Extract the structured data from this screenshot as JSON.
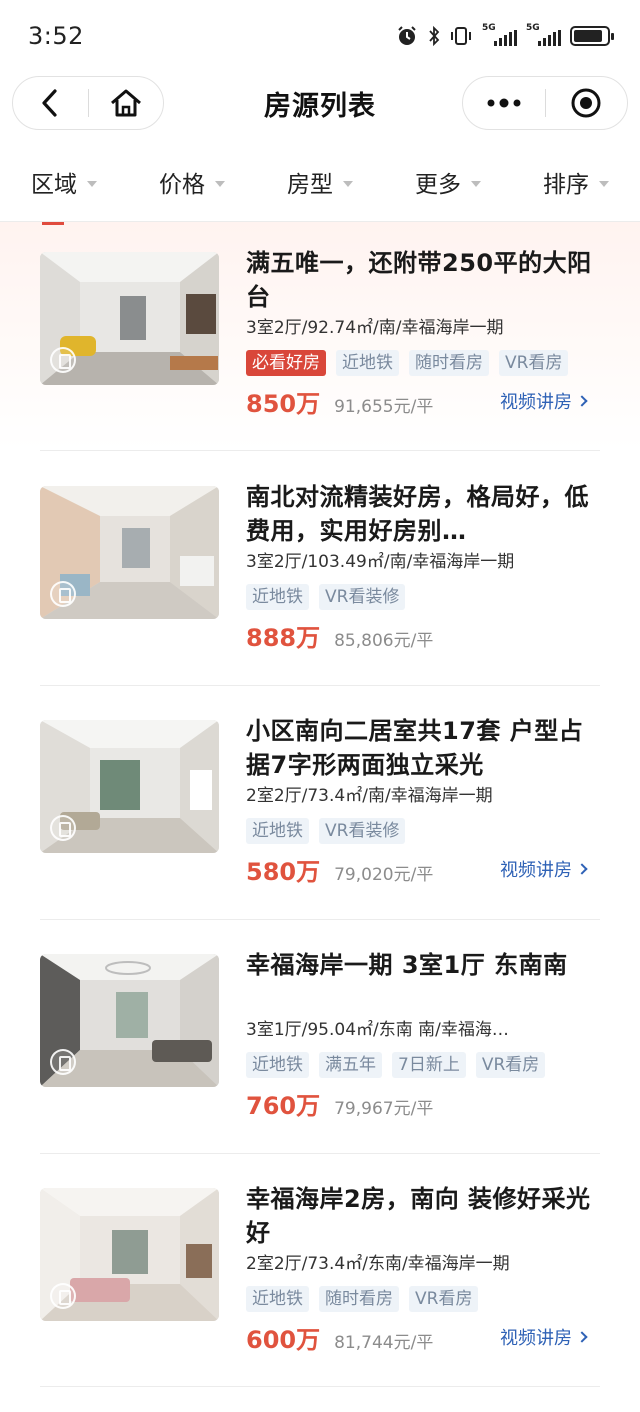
{
  "status_bar": {
    "time": "3:52",
    "icons": [
      "alarm-icon",
      "bluetooth-icon",
      "vibrate-icon",
      "signal-5g-icon",
      "signal-5g-icon",
      "battery-icon"
    ],
    "network_label_1": "5G",
    "network_label_2": "5G"
  },
  "nav": {
    "title": "房源列表",
    "back_icon": "back-arrow-icon",
    "home_icon": "home-icon",
    "more_icon": "more-dots-icon",
    "close_icon": "target-close-icon"
  },
  "filters": [
    {
      "label": "区域"
    },
    {
      "label": "价格"
    },
    {
      "label": "房型"
    },
    {
      "label": "更多"
    },
    {
      "label": "排序"
    }
  ],
  "listings": [
    {
      "title": "满五唯一，还附带250平的大阳台",
      "spec": "3室2厅/92.74㎡/南/幸福海岸一期",
      "tags": [
        "必看好房",
        "近地铁",
        "随时看房",
        "VR看房"
      ],
      "hot_tag": true,
      "price": "850万",
      "unit_price": "91,655元/平",
      "video_link": "视频讲房",
      "has_video": true
    },
    {
      "title": "南北对流精装好房，格局好，低费用，实用好房别…",
      "spec": "3室2厅/103.49㎡/南/幸福海岸一期",
      "tags": [
        "近地铁",
        "VR看装修"
      ],
      "hot_tag": false,
      "price": "888万",
      "unit_price": "85,806元/平",
      "video_link": "",
      "has_video": false
    },
    {
      "title": "小区南向二居室共17套 户型占据7字形两面独立采光",
      "spec": "2室2厅/73.4㎡/南/幸福海岸一期",
      "tags": [
        "近地铁",
        "VR看装修"
      ],
      "hot_tag": false,
      "price": "580万",
      "unit_price": "79,020元/平",
      "video_link": "视频讲房",
      "has_video": true
    },
    {
      "title": "幸福海岸一期 3室1厅 东南南",
      "spec": "3室1厅/95.04㎡/东南 南/幸福海…",
      "tags": [
        "近地铁",
        "满五年",
        "7日新上",
        "VR看房"
      ],
      "hot_tag": false,
      "price": "760万",
      "unit_price": "79,967元/平",
      "video_link": "",
      "has_video": false
    },
    {
      "title": "幸福海岸2房，南向 装修好采光好",
      "spec": "2室2厅/73.4㎡/东南/幸福海岸一期",
      "tags": [
        "近地铁",
        "随时看房",
        "VR看房"
      ],
      "hot_tag": false,
      "price": "600万",
      "unit_price": "81,744元/平",
      "video_link": "视频讲房",
      "has_video": true
    }
  ],
  "colors": {
    "price": "#e0533e",
    "hot_tag_bg": "#d9473a",
    "tag_text": "#7a8a9e",
    "tag_bg": "#eef3f8",
    "link": "#2f62b6"
  }
}
